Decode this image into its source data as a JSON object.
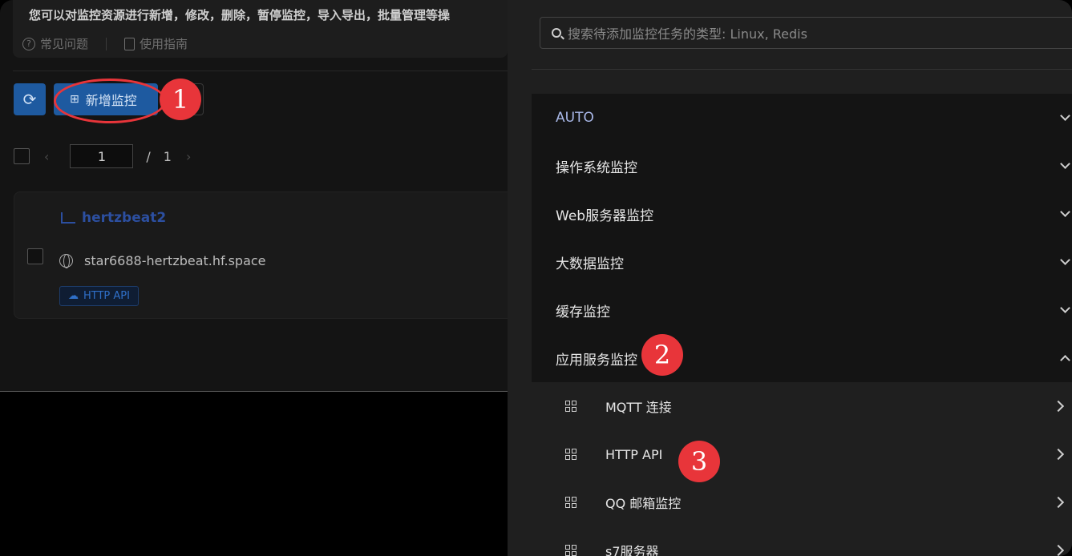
{
  "background_page": {
    "intro_text": "您可以对监控资源进行新增，修改，删除，暂停监控，导入导出，批量管理等操",
    "help_links": [
      "常见问题",
      "使用指南"
    ],
    "toolbar": {
      "add_monitor_label": "新增监控"
    },
    "pagination": {
      "current_page": "1",
      "separator": "/",
      "total_pages": "1"
    },
    "monitor_card": {
      "name": "hertzbeat2",
      "host": "star6688-hertzbeat.hf.space",
      "tag": "HTTP API"
    }
  },
  "drawer": {
    "search_placeholder": "搜索待添加监控任务的类型: Linux, Redis",
    "categories": [
      {
        "label": "AUTO",
        "expanded": false
      },
      {
        "label": "操作系统监控",
        "expanded": false
      },
      {
        "label": "Web服务器监控",
        "expanded": false
      },
      {
        "label": "大数据监控",
        "expanded": false
      },
      {
        "label": "缓存监控",
        "expanded": false
      },
      {
        "label": "应用服务监控",
        "expanded": true
      }
    ],
    "app_service_items": [
      "MQTT 连接",
      "HTTP API",
      "QQ 邮箱监控",
      "s7服务器"
    ]
  },
  "annotations": {
    "step1": "1",
    "step2": "2",
    "step3": "3",
    "color": "#e8353a"
  }
}
